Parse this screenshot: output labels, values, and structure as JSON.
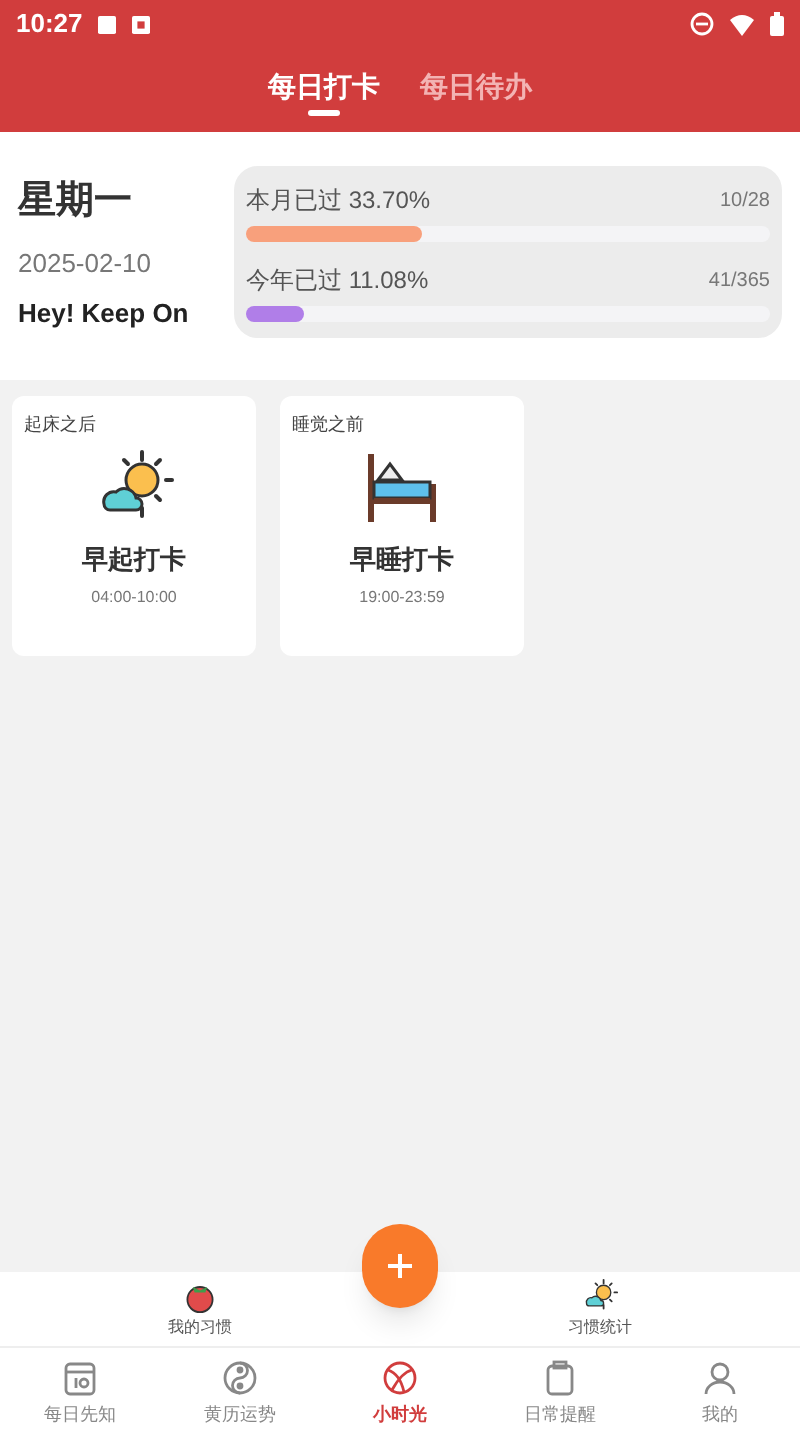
{
  "status_bar": {
    "time": "10:27"
  },
  "tabs": [
    {
      "label": "每日打卡",
      "selected": true
    },
    {
      "label": "每日待办",
      "selected": false
    }
  ],
  "summary": {
    "weekday": "星期一",
    "date": "2025-02-10",
    "motto": "Hey! Keep On"
  },
  "progress": [
    {
      "label": "本月已过 33.70%",
      "count": "10/28",
      "level": 0.337,
      "color": "#f8a07c"
    },
    {
      "label": "今年已过 11.08%",
      "count": "41/365",
      "level": 0.11,
      "color": "#b07ee8"
    }
  ],
  "habits": [
    {
      "kind": "sun",
      "category": "起床之后",
      "name": "早起打卡",
      "time": "04:00-10:00"
    },
    {
      "kind": "bed",
      "category": "睡觉之前",
      "name": "早睡打卡",
      "time": "19:00-23:59"
    }
  ],
  "habit_bar": [
    {
      "kind": "tomato",
      "label": "我的习惯"
    },
    {
      "kind": "sun",
      "label": "习惯统计"
    }
  ],
  "nav": [
    {
      "kind": "calendar",
      "label": "每日先知",
      "selected": false
    },
    {
      "kind": "yinyang",
      "label": "黄历运势",
      "selected": false
    },
    {
      "kind": "ball",
      "label": "小时光",
      "selected": true
    },
    {
      "kind": "clipboard",
      "label": "日常提醒",
      "selected": false
    },
    {
      "kind": "person",
      "label": "我的",
      "selected": false
    }
  ]
}
